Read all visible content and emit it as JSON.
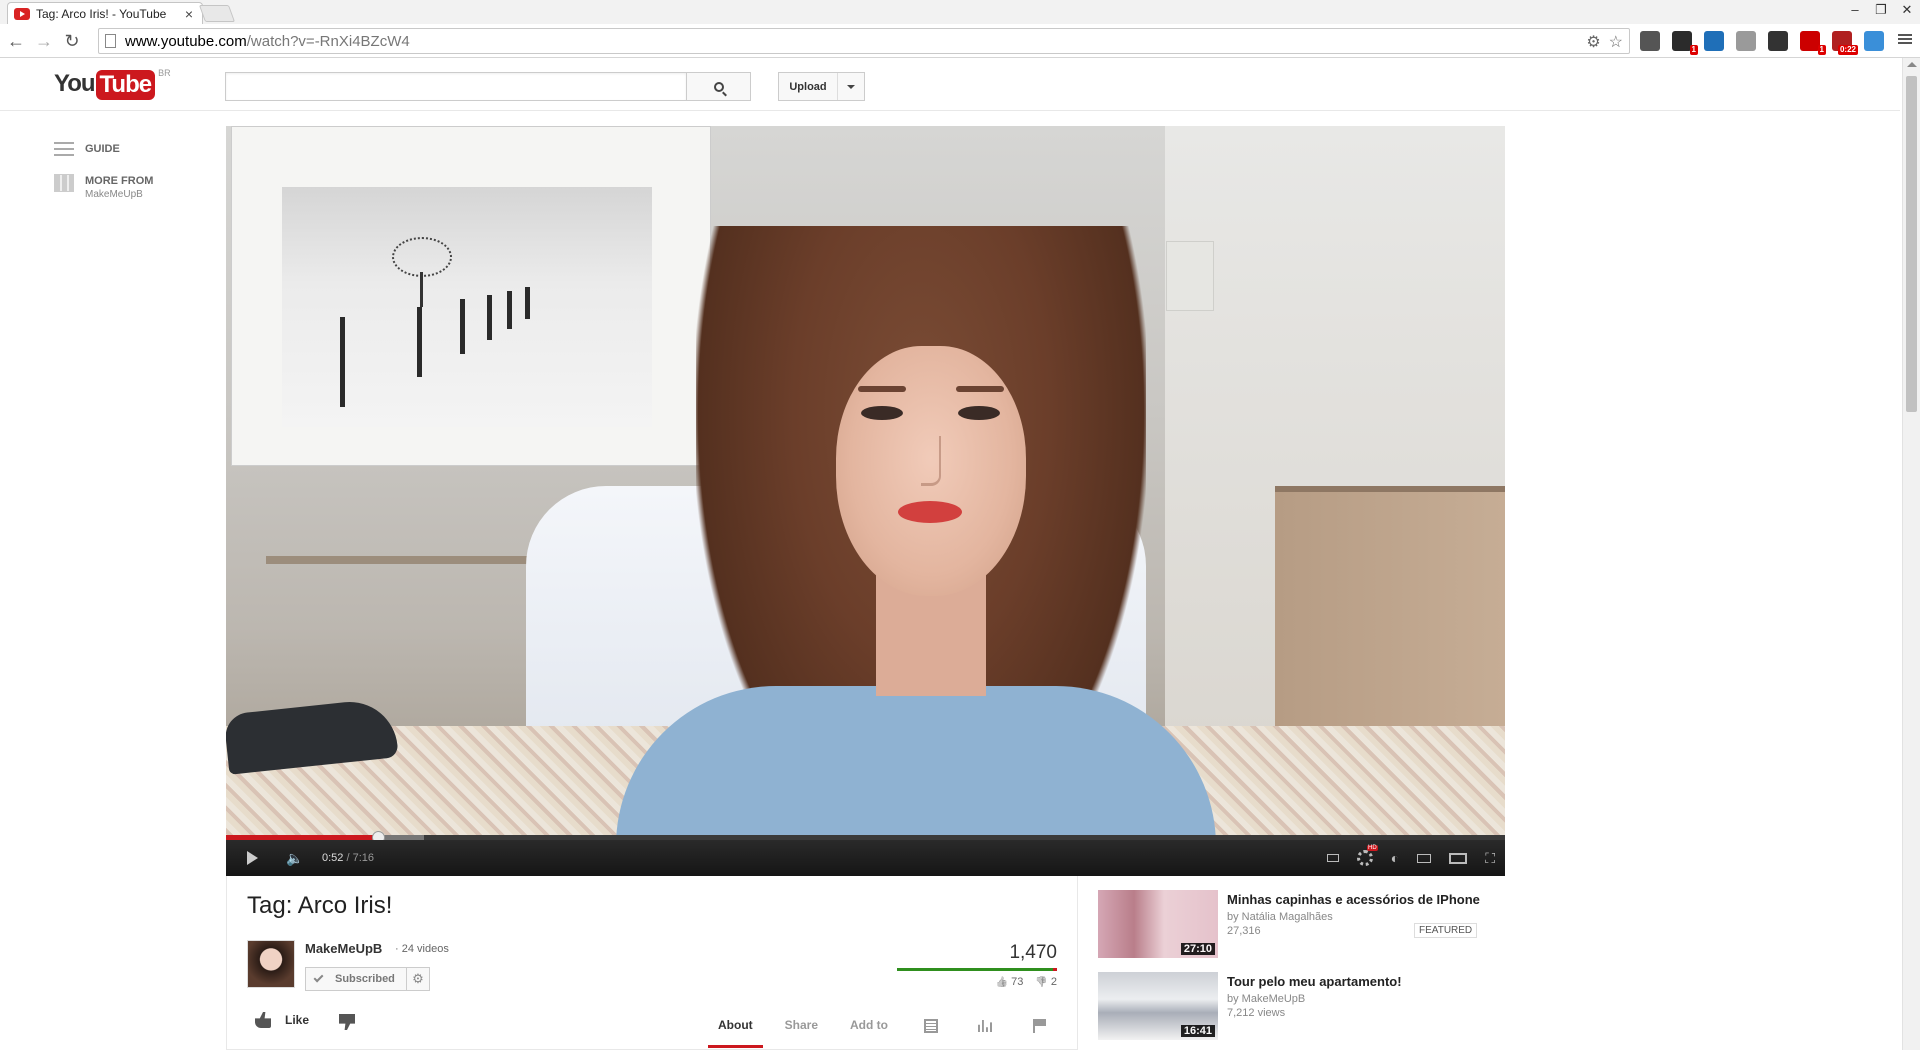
{
  "browser": {
    "tab_title": "Tag: Arco Iris! - YouTube",
    "tab_close": "×",
    "url_host": "www.youtube.com",
    "url_path": "/watch?v=-RnXi4BZcW4",
    "window_controls": [
      "‒",
      "❐",
      "✕"
    ],
    "extensions": [
      {
        "name": "mail-extension-icon",
        "color": "#555555",
        "badge": ""
      },
      {
        "name": "s-extension-icon",
        "color": "#2b2b2b",
        "badge": "1"
      },
      {
        "name": "tv-extension-icon",
        "color": "#1f6fb8",
        "badge": ""
      },
      {
        "name": "globe-extension-icon",
        "color": "#9a9a9a",
        "badge": ""
      },
      {
        "name": "info-extension-icon",
        "color": "#333333",
        "badge": ""
      },
      {
        "name": "ghostery-extension-icon",
        "color": "#cc0000",
        "badge": "1"
      },
      {
        "name": "counter-extension-icon",
        "color": "#b02020",
        "badge": "0:22"
      },
      {
        "name": "drive-extension-icon",
        "color": "#3a8fd9",
        "badge": ""
      }
    ]
  },
  "header": {
    "logo_you": "You",
    "logo_tube": "Tube",
    "logo_country": "BR",
    "search_placeholder": "",
    "upload_label": "Upload"
  },
  "guide": {
    "items": [
      {
        "label": "GUIDE",
        "sub": ""
      },
      {
        "label": "MORE FROM",
        "sub": "MakeMeUpB"
      }
    ]
  },
  "player": {
    "current_time": "0:52",
    "duration": "7:16",
    "played_fraction": 0.119,
    "loaded_fraction": 0.155
  },
  "video": {
    "title": "Tag: Arco Iris!",
    "channel": "MakeMeUpB",
    "video_count": "24 videos",
    "subscribed_label": "Subscribed",
    "views": "1,470",
    "likes": "73",
    "dislikes": "2",
    "like_label": "Like",
    "tabs": [
      "About",
      "Share",
      "Add to"
    ],
    "active_tab": "About"
  },
  "related": [
    {
      "title": "Minhas capinhas e acessórios de IPhone",
      "by": "by Natália Magalhães",
      "views": "27,316",
      "duration": "27:10",
      "badge": "FEATURED"
    },
    {
      "title": "Tour pelo meu apartamento!",
      "by": "by MakeMeUpB",
      "views": "7,212 views",
      "duration": "16:41",
      "badge": ""
    }
  ]
}
